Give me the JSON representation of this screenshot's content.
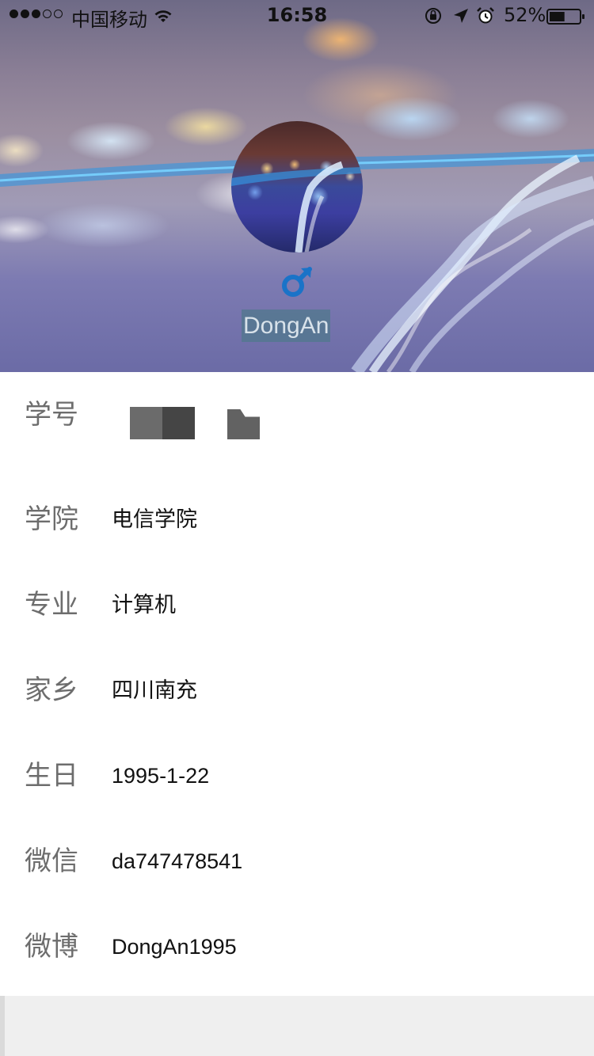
{
  "status_bar": {
    "carrier": "中国移动",
    "time": "16:58",
    "battery_percent": "52%",
    "battery_level": 0.52,
    "signal_strength": 3,
    "signal_max": 5,
    "icons": [
      "wifi-icon",
      "rotation-lock-icon",
      "location-icon",
      "alarm-icon",
      "battery-icon"
    ]
  },
  "profile": {
    "name": "DongAn",
    "gender_icon": "male-symbol-icon",
    "gender_color": "#1a73c8"
  },
  "info": {
    "rows": [
      {
        "label": "学号",
        "value": ""
      },
      {
        "label": "学院",
        "value": "电信学院"
      },
      {
        "label": "专业",
        "value": "计算机"
      },
      {
        "label": "家乡",
        "value": "四川南充"
      },
      {
        "label": "生日",
        "value": "1995-1-22"
      },
      {
        "label": "微信",
        "value": "da747478541"
      },
      {
        "label": "微博",
        "value": "DongAn1995"
      }
    ]
  }
}
